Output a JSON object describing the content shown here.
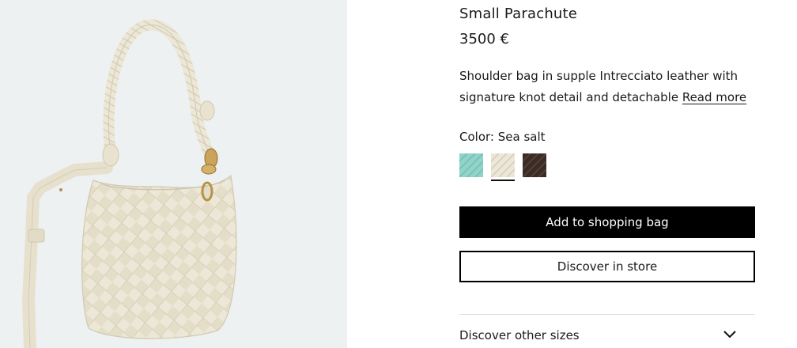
{
  "product": {
    "name": "Small Parachute",
    "price": "3500 €",
    "description": "Shoulder bag in supple Intrecciato leather with signature knot detail and detachable",
    "read_more": "Read more"
  },
  "color": {
    "label": "Color:",
    "selected": "Sea salt",
    "swatches": [
      {
        "name": "teal",
        "hex": "#8fd3c9",
        "selected": false
      },
      {
        "name": "sea-salt",
        "hex": "#ece7d8",
        "selected": true
      },
      {
        "name": "dark-brown",
        "hex": "#3a2c25",
        "selected": false
      }
    ]
  },
  "actions": {
    "add_to_bag": "Add to shopping bag",
    "discover_store": "Discover in store"
  },
  "sizes": {
    "label": "Discover other sizes",
    "icon": "chevron-down-icon"
  },
  "colors": {
    "gallery_bg": "#eef1f1",
    "bag": "#ece7d6",
    "primary_button": "#000000"
  }
}
